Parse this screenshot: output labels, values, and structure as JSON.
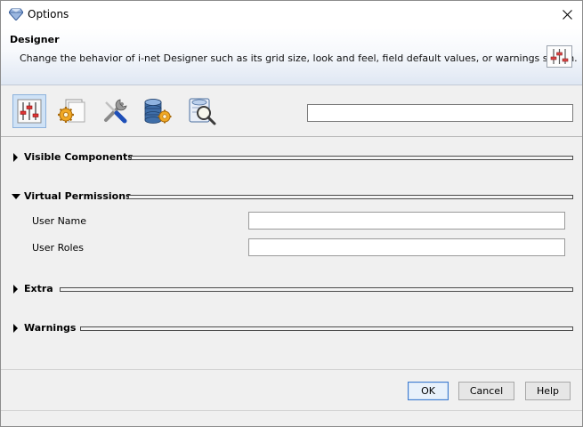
{
  "window": {
    "title": "Options"
  },
  "header": {
    "title": "Designer",
    "description": "Change the behavior of i-net Designer such as its grid size, look and feel, field default values, or warnings shown."
  },
  "toolbar": {
    "tools": [
      {
        "icon": "sliders-icon",
        "selected": true
      },
      {
        "icon": "folder-gear-icon",
        "selected": false
      },
      {
        "icon": "tools-icon",
        "selected": false
      },
      {
        "icon": "database-gear-icon",
        "selected": false
      },
      {
        "icon": "database-search-icon",
        "selected": false
      }
    ],
    "search_value": ""
  },
  "sections": {
    "visible_components": {
      "label": "Visible Components",
      "expanded": false
    },
    "virtual_permissions": {
      "label": "Virtual Permissions",
      "expanded": true
    },
    "extra": {
      "label": "Extra",
      "expanded": false
    },
    "warnings": {
      "label": "Warnings",
      "expanded": false
    }
  },
  "fields": {
    "user_name": {
      "label": "User Name",
      "value": ""
    },
    "user_roles": {
      "label": "User Roles",
      "value": ""
    }
  },
  "buttons": {
    "ok": "OK",
    "cancel": "Cancel",
    "help": "Help"
  },
  "colors": {
    "accent": "#3d7bd0",
    "selected_tool_bg": "#cfe2f6",
    "header_gradient_end": "#dfe7f3"
  }
}
